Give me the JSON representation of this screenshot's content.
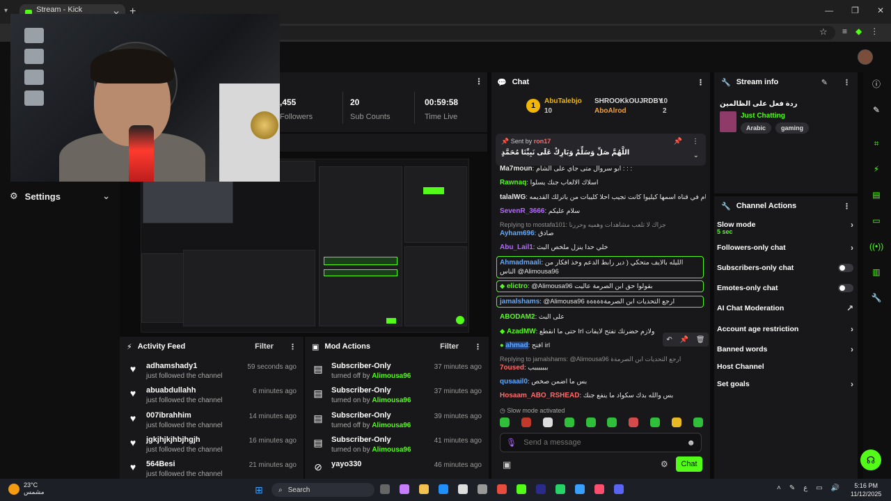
{
  "browser": {
    "tab_title": "Stream - Kick Dashboard",
    "tab_close": "✕",
    "new_tab": "+",
    "window_controls": [
      "—",
      "❐",
      "✕"
    ]
  },
  "sidebar": {
    "settings_label": "Settings"
  },
  "stats": {
    "followers_value": ",455",
    "followers_label": "Followers",
    "subs_value": "20",
    "subs_label": "Sub Counts",
    "time_value": "00:59:58",
    "time_label": "Time Live"
  },
  "activity_feed": {
    "title": "Activity Feed",
    "filter": "Filter",
    "items": [
      {
        "name": "adhamshady1",
        "sub": "just followed the channel",
        "time": "59 seconds ago"
      },
      {
        "name": "abuabdullahh",
        "sub": "just followed the channel",
        "time": "6 minutes ago"
      },
      {
        "name": "007ibrahhim",
        "sub": "just followed the channel",
        "time": "14 minutes ago"
      },
      {
        "name": "jgkjhjkjhbjhgjh",
        "sub": "just followed the channel",
        "time": "16 minutes ago"
      },
      {
        "name": "564Besi",
        "sub": "just followed the channel",
        "time": "21 minutes ago"
      }
    ]
  },
  "mod_actions": {
    "title": "Mod Actions",
    "filter": "Filter",
    "items": [
      {
        "name": "Subscriber-Only",
        "pre": "turned off by",
        "by": "Alimousa96",
        "time": "37 minutes ago"
      },
      {
        "name": "Subscriber-Only",
        "pre": "turned on by",
        "by": "Alimousa96",
        "time": "37 minutes ago"
      },
      {
        "name": "Subscriber-Only",
        "pre": "turned off by",
        "by": "Alimousa96",
        "time": "39 minutes ago"
      },
      {
        "name": "Subscriber-Only",
        "pre": "turned on by",
        "by": "Alimousa96",
        "time": "41 minutes ago"
      },
      {
        "name": "yayo330",
        "pre": "",
        "by": "",
        "time": "46 minutes ago"
      }
    ]
  },
  "chat": {
    "title": "Chat",
    "leaderboard": [
      {
        "name": "AbuTalebjo",
        "count": "10"
      },
      {
        "name": "SHROOKkOUJRDBY",
        "count": "10"
      },
      {
        "name": "AboAlrod",
        "count": "2"
      }
    ],
    "pinned": {
      "sent_by_label": "Sent by",
      "sent_by": "ron17",
      "text": "اللَّهُمَّ صَلِّ وَسَلِّمْ وَبَارِكْ عَلَى نَبِيِّنَا مُحَمَّدٍ"
    },
    "messages": [
      {
        "user": "Ma7moun",
        "color": "#d0d0d0",
        "text": "ابو سروال متى جاي على الشام : : :"
      },
      {
        "user": "Rawnaq",
        "color": "#53fc18",
        "text": "اسلاك الالعاب جنك يسلوا"
      },
      {
        "user": "talalWG",
        "color": "#e8e8e8",
        "text": "تمام في قناه اسمها كيليوا كانت تجيب احلا كليبات من باترلك القديمه"
      },
      {
        "user": "SevenR_3666",
        "color": "#b46bff",
        "text": "سلام عليكم"
      },
      {
        "user": "Ayham696",
        "color": "#5fa8ff",
        "text": "صادق"
      },
      {
        "user": "Abu_Lail1",
        "color": "#b46bff",
        "text": "خلي حدا ينزل ملخص البث"
      },
      {
        "user": "Ahmadmaali",
        "color": "#5fa8ff",
        "text": "الليله بالايف متحكي ( دير رابط الدعم وخذ افكار من الناس @Alimousa96"
      },
      {
        "user": "elictro",
        "color": "#53fc18",
        "text": "@Alimousa96 بقولوا حق ابن الصرمة عاليت"
      },
      {
        "user": "jamalshams",
        "color": "#5fa8ff",
        "text": "@Alimousa96 ارجع التحديات ابن الصرمةةةةةة"
      },
      {
        "user": "ABODAM2",
        "color": "#53fc18",
        "text": "على البث"
      },
      {
        "user": "AzadMW",
        "color": "#53fc18",
        "text": "حتى ما انقطع Irl ولازم حضرتك تفتح لايفات"
      },
      {
        "user": "ahmad",
        "color": "#5fa8ff",
        "text": "افتح irl"
      },
      {
        "user": "7oused",
        "color": "#ff6b6b",
        "text": "بببببببب"
      },
      {
        "user": "qusaail0",
        "color": "#5fa8ff",
        "text": "بس ما اضمن صخص"
      },
      {
        "user": "Hosaam_ABO_RSHEAD",
        "color": "#ff6b6b",
        "text": "بس والله بدك سكواد ما ينفع جنك"
      }
    ],
    "reply1": "Replying to mostafa101: جزاك لا تلعب مشاهدات وهميه وحررنا",
    "reply2": "Replying to jamalshams: @Alimousa96 ارجع التحديات ابن الصرمةة",
    "slow_mode_note": "Slow mode activated",
    "send_placeholder": "Send a message",
    "send_button": "Chat"
  },
  "stream_info": {
    "title_label": "Stream info",
    "stream_title": "ردة فعل على الظالمين",
    "category": "Just Chatting",
    "tags": [
      "Arabic",
      "gaming"
    ]
  },
  "channel_actions": {
    "title": "Channel Actions",
    "slow_mode": "Slow mode",
    "slow_mode_value": "5 sec",
    "followers_only": "Followers-only chat",
    "subscribers_only": "Subscribers-only chat",
    "emotes_only": "Emotes-only chat",
    "ai_moderation": "AI Chat Moderation",
    "account_age": "Account age restriction",
    "banned_words": "Banned words",
    "host_channel": "Host Channel",
    "set_goals": "Set goals"
  },
  "taskbar": {
    "temperature": "23°C",
    "weather_text": "مشمس",
    "search_label": "Search",
    "time": "5:16 PM",
    "date": "11/12/2025"
  },
  "icons": {
    "settings": "gear-icon",
    "heart": "heart-icon",
    "gift": "gift-icon",
    "pin": "pin-icon",
    "mic": "mic-icon",
    "accent": "#53fc18"
  }
}
